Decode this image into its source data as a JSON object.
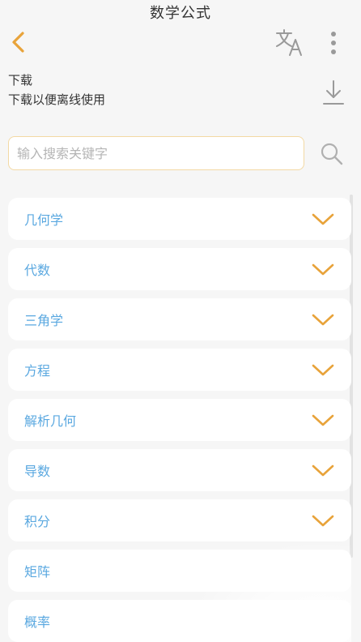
{
  "app": {
    "title": "数学公式"
  },
  "toolbar": {
    "back_icon": "chevron-left-icon",
    "translate_icon": "translate-icon",
    "more_icon": "more-vertical-icon"
  },
  "download": {
    "title": "下载",
    "subtitle": "下载以便离线使用",
    "icon": "download-icon"
  },
  "search": {
    "placeholder": "输入搜索关键字",
    "value": "",
    "icon": "search-icon"
  },
  "categories": [
    {
      "label": "几何学",
      "expandable": true
    },
    {
      "label": "代数",
      "expandable": true
    },
    {
      "label": "三角学",
      "expandable": true
    },
    {
      "label": "方程",
      "expandable": true
    },
    {
      "label": "解析几何",
      "expandable": true
    },
    {
      "label": "导数",
      "expandable": true
    },
    {
      "label": "积分",
      "expandable": true
    },
    {
      "label": "矩阵",
      "expandable": false
    },
    {
      "label": "概率",
      "expandable": false
    }
  ],
  "colors": {
    "accent": "#e8a33a",
    "label": "#5aa8e0",
    "background": "#f6f6f6",
    "card": "#ffffff",
    "icon_gray": "#9a9a9a"
  }
}
